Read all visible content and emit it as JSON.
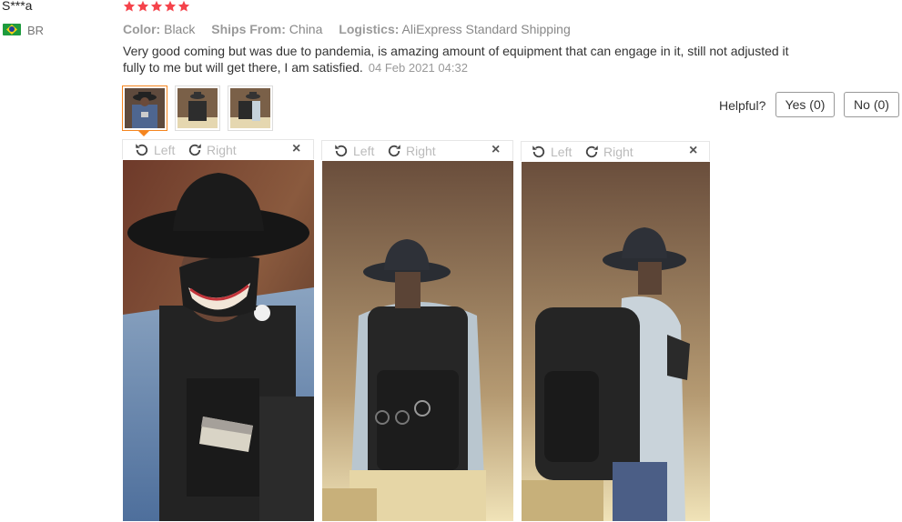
{
  "reviewer": {
    "name": "S***a",
    "country_code": "BR",
    "flag": "brazil-flag"
  },
  "rating": {
    "stars": 5,
    "max": 5,
    "color": "#f5434b"
  },
  "meta": {
    "color_label": "Color:",
    "color_value": "Black",
    "ships_label": "Ships From:",
    "ships_value": "China",
    "logistics_label": "Logistics:",
    "logistics_value": "AliExpress Standard Shipping"
  },
  "review": {
    "text": "Very good coming but was due to pandemia, is amazing amount of equipment that can engage in it, still not adjusted it fully to me but will get there, I am satisfied.",
    "date": "04 Feb 2021 04:32"
  },
  "helpful": {
    "label": "Helpful?",
    "yes_label": "Yes (0)",
    "no_label": "No (0)"
  },
  "viewer": {
    "left_label": "Left",
    "right_label": "Right",
    "close_glyph": "×"
  },
  "colors": {
    "accent": "#f5851f"
  }
}
